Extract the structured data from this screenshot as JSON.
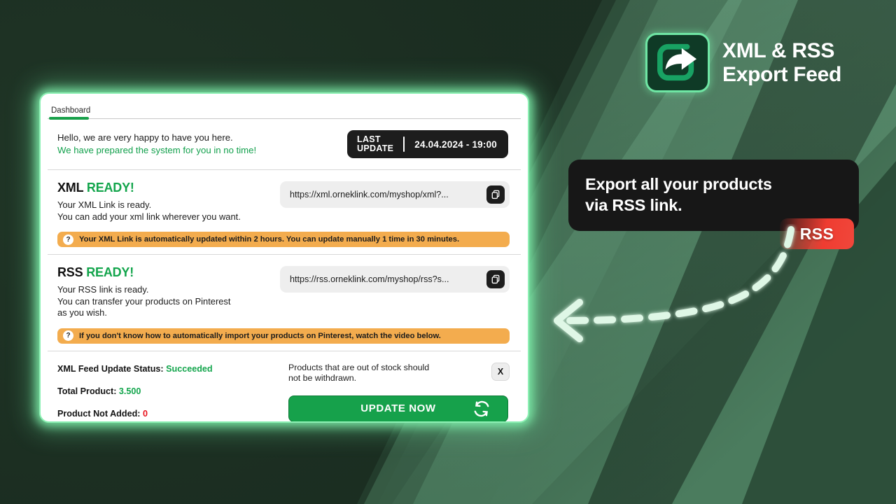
{
  "promo": {
    "logo_icon": "share-export-icon",
    "title_line1": "XML & RSS",
    "title_line2": "Export Feed",
    "callout_line1": "Export all your products",
    "callout_line2": "via RSS link.",
    "rss_badge": "RSS",
    "arrow_icon": "dashed-curved-arrow-icon",
    "accent_green": "#6fe6a4",
    "callout_bg": "#171717",
    "rss_red": "#ef3c31"
  },
  "card": {
    "tab": "Dashboard",
    "greeting": {
      "line1": "Hello, we are very happy to have you here.",
      "line2": "We have prepared the system for you in no time!"
    },
    "last_update": {
      "label_line1": "LAST",
      "label_line2": "UPDATE",
      "value": "24.04.2024 - 19:00"
    },
    "xml": {
      "title": "XML",
      "status": "READY!",
      "desc_line1": "Your XML Link is ready.",
      "desc_line2": "You can add your xml link wherever you want.",
      "link": "https://xml.orneklink.com/myshop/xml?...",
      "copy_icon": "copy-icon",
      "note_icon": "question-mark-icon",
      "note": "Your XML Link is automatically updated within 2 hours. You can update manually 1 time in 30 minutes."
    },
    "rss": {
      "title": "RSS",
      "status": "READY!",
      "desc_line1": "Your RSS link is ready.",
      "desc_line2": "You can transfer your products on Pinterest",
      "desc_line3": "as you wish.",
      "link": "https://rss.orneklink.com/myshop/rss?s...",
      "copy_icon": "copy-icon",
      "note_icon": "question-mark-icon",
      "note": "If you don't know how to automatically import your products on Pinterest, watch the video below."
    },
    "footer": {
      "status_label": "XML Feed Update Status:",
      "status_value": "Succeeded",
      "total_label": "Total Product:",
      "total_value": "3.500",
      "notadded_label": "Product Not Added:",
      "notadded_value": "0",
      "note_line1": "Products that are out of stock should",
      "note_line2": "not be withdrawn.",
      "close_label": "X",
      "update_button": "UPDATE NOW",
      "update_icon": "refresh-icon"
    }
  }
}
